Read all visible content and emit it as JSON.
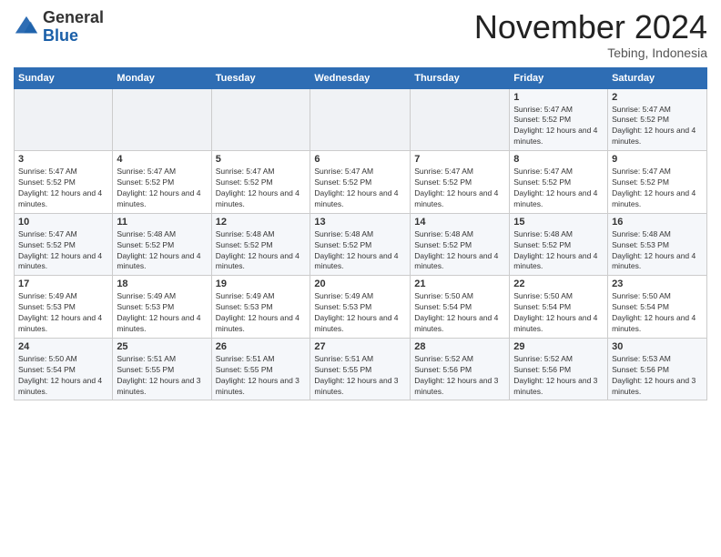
{
  "logo": {
    "general": "General",
    "blue": "Blue"
  },
  "header": {
    "month": "November 2024",
    "location": "Tebing, Indonesia"
  },
  "days_of_week": [
    "Sunday",
    "Monday",
    "Tuesday",
    "Wednesday",
    "Thursday",
    "Friday",
    "Saturday"
  ],
  "weeks": [
    [
      {
        "day": "",
        "info": ""
      },
      {
        "day": "",
        "info": ""
      },
      {
        "day": "",
        "info": ""
      },
      {
        "day": "",
        "info": ""
      },
      {
        "day": "",
        "info": ""
      },
      {
        "day": "1",
        "info": "Sunrise: 5:47 AM\nSunset: 5:52 PM\nDaylight: 12 hours and 4 minutes."
      },
      {
        "day": "2",
        "info": "Sunrise: 5:47 AM\nSunset: 5:52 PM\nDaylight: 12 hours and 4 minutes."
      }
    ],
    [
      {
        "day": "3",
        "info": "Sunrise: 5:47 AM\nSunset: 5:52 PM\nDaylight: 12 hours and 4 minutes."
      },
      {
        "day": "4",
        "info": "Sunrise: 5:47 AM\nSunset: 5:52 PM\nDaylight: 12 hours and 4 minutes."
      },
      {
        "day": "5",
        "info": "Sunrise: 5:47 AM\nSunset: 5:52 PM\nDaylight: 12 hours and 4 minutes."
      },
      {
        "day": "6",
        "info": "Sunrise: 5:47 AM\nSunset: 5:52 PM\nDaylight: 12 hours and 4 minutes."
      },
      {
        "day": "7",
        "info": "Sunrise: 5:47 AM\nSunset: 5:52 PM\nDaylight: 12 hours and 4 minutes."
      },
      {
        "day": "8",
        "info": "Sunrise: 5:47 AM\nSunset: 5:52 PM\nDaylight: 12 hours and 4 minutes."
      },
      {
        "day": "9",
        "info": "Sunrise: 5:47 AM\nSunset: 5:52 PM\nDaylight: 12 hours and 4 minutes."
      }
    ],
    [
      {
        "day": "10",
        "info": "Sunrise: 5:47 AM\nSunset: 5:52 PM\nDaylight: 12 hours and 4 minutes."
      },
      {
        "day": "11",
        "info": "Sunrise: 5:48 AM\nSunset: 5:52 PM\nDaylight: 12 hours and 4 minutes."
      },
      {
        "day": "12",
        "info": "Sunrise: 5:48 AM\nSunset: 5:52 PM\nDaylight: 12 hours and 4 minutes."
      },
      {
        "day": "13",
        "info": "Sunrise: 5:48 AM\nSunset: 5:52 PM\nDaylight: 12 hours and 4 minutes."
      },
      {
        "day": "14",
        "info": "Sunrise: 5:48 AM\nSunset: 5:52 PM\nDaylight: 12 hours and 4 minutes."
      },
      {
        "day": "15",
        "info": "Sunrise: 5:48 AM\nSunset: 5:52 PM\nDaylight: 12 hours and 4 minutes."
      },
      {
        "day": "16",
        "info": "Sunrise: 5:48 AM\nSunset: 5:53 PM\nDaylight: 12 hours and 4 minutes."
      }
    ],
    [
      {
        "day": "17",
        "info": "Sunrise: 5:49 AM\nSunset: 5:53 PM\nDaylight: 12 hours and 4 minutes."
      },
      {
        "day": "18",
        "info": "Sunrise: 5:49 AM\nSunset: 5:53 PM\nDaylight: 12 hours and 4 minutes."
      },
      {
        "day": "19",
        "info": "Sunrise: 5:49 AM\nSunset: 5:53 PM\nDaylight: 12 hours and 4 minutes."
      },
      {
        "day": "20",
        "info": "Sunrise: 5:49 AM\nSunset: 5:53 PM\nDaylight: 12 hours and 4 minutes."
      },
      {
        "day": "21",
        "info": "Sunrise: 5:50 AM\nSunset: 5:54 PM\nDaylight: 12 hours and 4 minutes."
      },
      {
        "day": "22",
        "info": "Sunrise: 5:50 AM\nSunset: 5:54 PM\nDaylight: 12 hours and 4 minutes."
      },
      {
        "day": "23",
        "info": "Sunrise: 5:50 AM\nSunset: 5:54 PM\nDaylight: 12 hours and 4 minutes."
      }
    ],
    [
      {
        "day": "24",
        "info": "Sunrise: 5:50 AM\nSunset: 5:54 PM\nDaylight: 12 hours and 4 minutes."
      },
      {
        "day": "25",
        "info": "Sunrise: 5:51 AM\nSunset: 5:55 PM\nDaylight: 12 hours and 3 minutes."
      },
      {
        "day": "26",
        "info": "Sunrise: 5:51 AM\nSunset: 5:55 PM\nDaylight: 12 hours and 3 minutes."
      },
      {
        "day": "27",
        "info": "Sunrise: 5:51 AM\nSunset: 5:55 PM\nDaylight: 12 hours and 3 minutes."
      },
      {
        "day": "28",
        "info": "Sunrise: 5:52 AM\nSunset: 5:56 PM\nDaylight: 12 hours and 3 minutes."
      },
      {
        "day": "29",
        "info": "Sunrise: 5:52 AM\nSunset: 5:56 PM\nDaylight: 12 hours and 3 minutes."
      },
      {
        "day": "30",
        "info": "Sunrise: 5:53 AM\nSunset: 5:56 PM\nDaylight: 12 hours and 3 minutes."
      }
    ]
  ]
}
